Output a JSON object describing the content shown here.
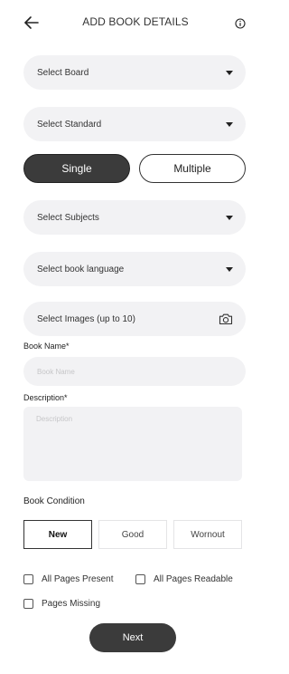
{
  "header": {
    "title": "ADD BOOK DETAILS",
    "back_icon": "arrow-left-icon",
    "info_icon": "info-circle-icon"
  },
  "selects": {
    "board": "Select Board",
    "standard": "Select Standard",
    "subjects": "Select Subjects",
    "language": "Select book language",
    "images": "Select Images (up to 10)",
    "images_icon": "camera-icon"
  },
  "type_toggle": {
    "options": [
      "Single",
      "Multiple"
    ],
    "selected": "Single"
  },
  "book_name": {
    "label": "Book Name*",
    "placeholder": "Book Name",
    "value": ""
  },
  "description": {
    "label": "Description*",
    "placeholder": "Description",
    "value": ""
  },
  "condition": {
    "label": "Book Condition",
    "options": [
      "New",
      "Good",
      "Wornout"
    ],
    "selected": "New"
  },
  "checks": {
    "all_pages_present": "All Pages Present",
    "all_pages_readable": "All Pages Readable",
    "pages_missing": "Pages Missing"
  },
  "next_label": "Next",
  "colors": {
    "accent_dark": "#3b3b3b",
    "field_bg": "#f2f2f4"
  }
}
